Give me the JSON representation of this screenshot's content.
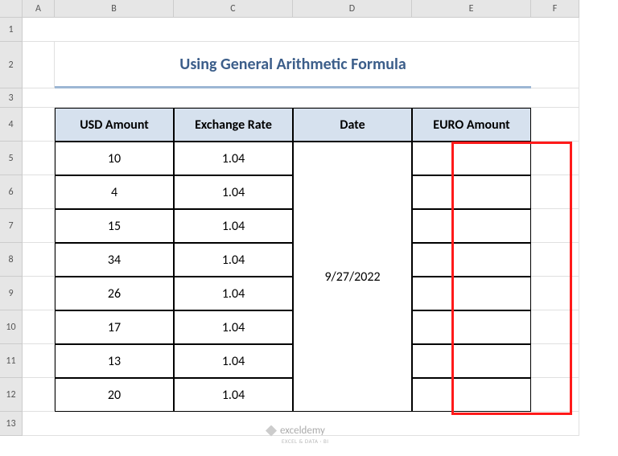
{
  "columns": [
    "A",
    "B",
    "C",
    "D",
    "E",
    "F"
  ],
  "rows": [
    "1",
    "2",
    "3",
    "4",
    "5",
    "6",
    "7",
    "8",
    "9",
    "10",
    "11",
    "12",
    "13"
  ],
  "title": "Using General Arithmetic Formula",
  "headers": {
    "usd": "USD Amount",
    "rate": "Exchange Rate",
    "date": "Date",
    "euro": "EURO Amount"
  },
  "chart_data": {
    "type": "table",
    "columns": [
      "USD Amount",
      "Exchange Rate",
      "Date",
      "EURO Amount"
    ],
    "rows": [
      {
        "usd": 10,
        "rate": 1.04,
        "date": "9/27/2022",
        "euro": ""
      },
      {
        "usd": 4,
        "rate": 1.04,
        "date": "9/27/2022",
        "euro": ""
      },
      {
        "usd": 15,
        "rate": 1.04,
        "date": "9/27/2022",
        "euro": ""
      },
      {
        "usd": 34,
        "rate": 1.04,
        "date": "9/27/2022",
        "euro": ""
      },
      {
        "usd": 26,
        "rate": 1.04,
        "date": "9/27/2022",
        "euro": ""
      },
      {
        "usd": 17,
        "rate": 1.04,
        "date": "9/27/2022",
        "euro": ""
      },
      {
        "usd": 13,
        "rate": 1.04,
        "date": "9/27/2022",
        "euro": ""
      },
      {
        "usd": 20,
        "rate": 1.04,
        "date": "9/27/2022",
        "euro": ""
      }
    ]
  },
  "date_merged": "9/27/2022",
  "watermark": "exceldemy",
  "watermark_sub": "EXCEL & DATA · BI"
}
